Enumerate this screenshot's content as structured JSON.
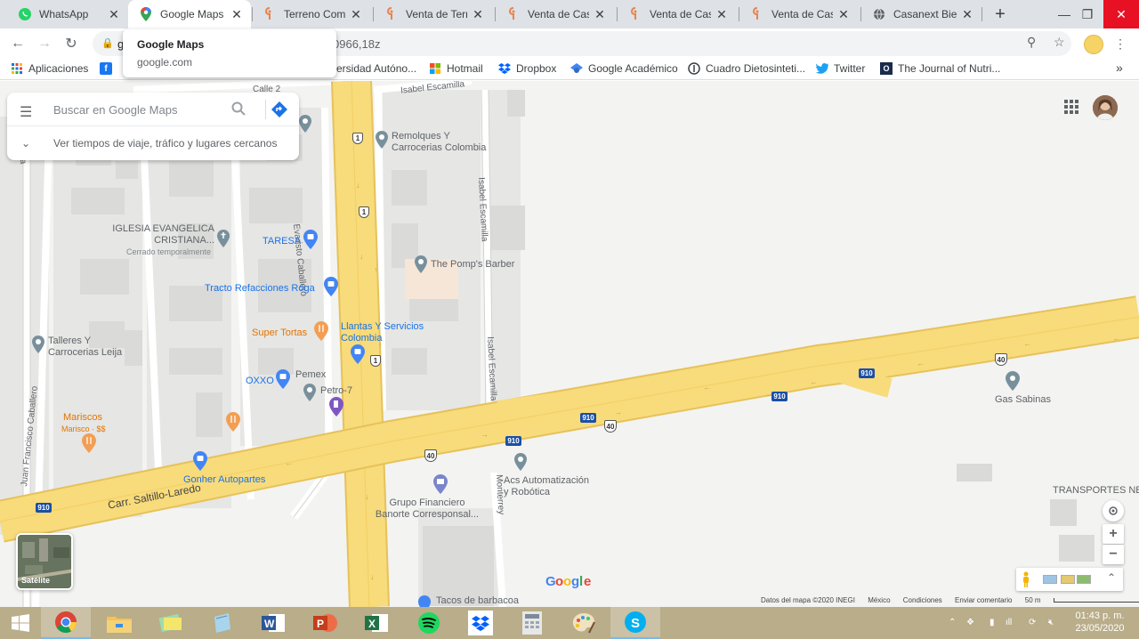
{
  "browser": {
    "tabs": [
      {
        "title": "WhatsApp",
        "favicon": "whatsapp-icon",
        "active": false
      },
      {
        "title": "Google Maps",
        "favicon": "google-maps-icon",
        "active": true
      },
      {
        "title": "Terreno Comer",
        "favicon": "realestate-icon",
        "active": false
      },
      {
        "title": "Venta de Terre",
        "favicon": "realestate-icon",
        "active": false
      },
      {
        "title": "Venta de Casa",
        "favicon": "realestate-icon",
        "active": false
      },
      {
        "title": "Venta de Casa",
        "favicon": "realestate-icon",
        "active": false
      },
      {
        "title": "Venta de Casa",
        "favicon": "realestate-icon",
        "active": false
      },
      {
        "title": "Casanext Biene",
        "favicon": "globe-icon",
        "active": false
      }
    ],
    "url_visible_start": "g",
    "url_visible_end": "0966,18z",
    "hover_card": {
      "title": "Google Maps",
      "domain": "google.com"
    },
    "bookmarks": [
      {
        "label": "Aplicaciones",
        "icon": "apps-icon"
      },
      {
        "label": "",
        "icon": "facebook-icon"
      },
      {
        "label": "versidad Autóno...",
        "icon": "university-icon"
      },
      {
        "label": "Hotmail",
        "icon": "microsoft-icon"
      },
      {
        "label": "Dropbox",
        "icon": "dropbox-icon"
      },
      {
        "label": "Google Académico",
        "icon": "scholar-icon"
      },
      {
        "label": "Cuadro Dietosinteti...",
        "icon": "site-icon"
      },
      {
        "label": "Twitter",
        "icon": "twitter-icon"
      },
      {
        "label": "The Journal of Nutri...",
        "icon": "journal-icon"
      }
    ],
    "more_bookmarks": "»"
  },
  "maps": {
    "search_placeholder": "Buscar en Google Maps",
    "nearby_text": "Ver tiempos de viaje, tráfico y lugares cercanos",
    "satellite_label": "Satélite",
    "google_logo": "Google",
    "attribution": [
      "Datos del mapa ©2020 INEGI",
      "México",
      "Condiciones",
      "Enviar comentario",
      "50 m"
    ],
    "streets": [
      {
        "name": "Calle 2"
      },
      {
        "name": "Isabel Escamilla"
      },
      {
        "name": "Evaristo Caballero"
      },
      {
        "name": "Isabel Escamilla"
      },
      {
        "name": "Isabel Escamilla"
      },
      {
        "name": "Juan Francisco Caballero"
      },
      {
        "name": "Carr. Saltillo-Laredo"
      },
      {
        "name": "Monterrey"
      },
      {
        "name": "Ra"
      }
    ],
    "highway_shields": [
      "910",
      "910",
      "910",
      "910",
      "910"
    ],
    "route_40": [
      "40",
      "40",
      "40"
    ],
    "route_1": [
      "1",
      "1",
      "1"
    ],
    "places": [
      {
        "name": "Remolques Y",
        "name2": "Carrocerias Colombia",
        "color": "gray"
      },
      {
        "name": "IGLESIA EVANGELICA",
        "name2": "CRISTIANA...",
        "sub": "Cerrado temporalmente",
        "color": "gray"
      },
      {
        "name": "TARESA",
        "color": "blue"
      },
      {
        "name": "The Pomp's Barber",
        "color": "gray"
      },
      {
        "name": "Tracto Refacciones Roga",
        "color": "blue"
      },
      {
        "name": "Super Tortas",
        "color": "orange"
      },
      {
        "name": "Llantas Y Servicios",
        "name2": "Colombia",
        "color": "blue"
      },
      {
        "name": "Talleres Y",
        "name2": "Carrocerias Leija",
        "color": "gray"
      },
      {
        "name": "OXXO",
        "color": "blue"
      },
      {
        "name": "Pemex",
        "color": "gray"
      },
      {
        "name": "Petro-7",
        "color": "gray"
      },
      {
        "name": "Mariscos",
        "sub": "Marisco · $$",
        "color": "orange"
      },
      {
        "name": "Gonher Autopartes",
        "color": "blue"
      },
      {
        "name": "Acs Automatización",
        "name2": "y Robótica",
        "color": "gray"
      },
      {
        "name": "Grupo Financiero",
        "name2": "Banorte Corresponsal...",
        "color": "gray"
      },
      {
        "name": "Gas Sabinas",
        "color": "gray"
      },
      {
        "name": "TRANSPORTES NE",
        "color": "gray"
      },
      {
        "name": "Tacos de barbacoa",
        "color": "gray"
      }
    ]
  },
  "taskbar": {
    "apps": [
      "windows-start-icon",
      "chrome-icon",
      "file-explorer-icon",
      "sticky-notes-icon",
      "notepad-icon",
      "word-icon",
      "powerpoint-icon",
      "excel-icon",
      "spotify-icon",
      "dropbox-icon",
      "calculator-icon",
      "paint-icon",
      "skype-icon"
    ],
    "time": "01:43 p. m.",
    "date": "23/05/2020"
  },
  "colors": {
    "map_bg": "#f3f3f1",
    "highway": "#f8db7b",
    "highway_edge": "#e6c25a",
    "road": "#ffffff",
    "block": "#e8e8e8",
    "taskbar": "#b9ad8a"
  }
}
